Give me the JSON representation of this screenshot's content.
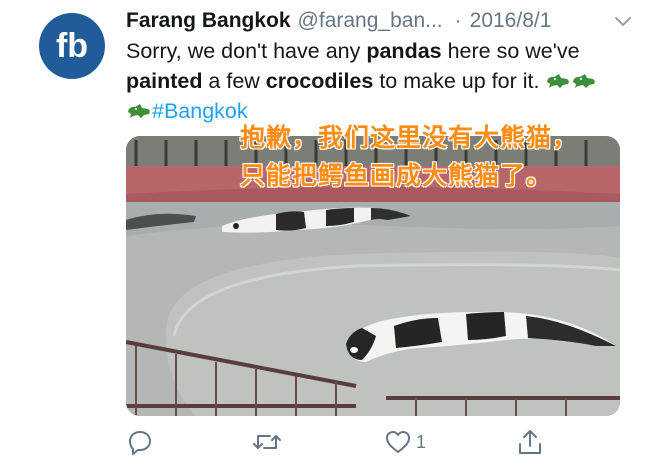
{
  "tweet": {
    "avatar_letters": "fb",
    "author_name": "Farang Bangkok",
    "handle": "@farang_ban...",
    "separator": "·",
    "date": "2016/8/1",
    "text": {
      "p1": "Sorry, we don't have any ",
      "b1": "pandas",
      "p2": " here so we've ",
      "b2": "painted",
      "p3": " a few ",
      "b3": "crocodiles",
      "p4": " to make up for it. ",
      "hashtag": "#Bangkok"
    },
    "emoji": [
      "crocodile-emoji",
      "crocodile-emoji",
      "crocodile-emoji"
    ]
  },
  "media": {
    "overlay_line1": "抱歉，我们这里没有大熊猫，",
    "overlay_line2": "只能把鳄鱼画成大熊猫了。"
  },
  "actions": {
    "reply_count": "",
    "retweet_count": "",
    "like_count": "1",
    "share_count": ""
  },
  "colors": {
    "avatar_bg": "#1f5c99",
    "link": "#1da1f2",
    "muted": "#657786",
    "overlay_text": "#ff8c12"
  }
}
